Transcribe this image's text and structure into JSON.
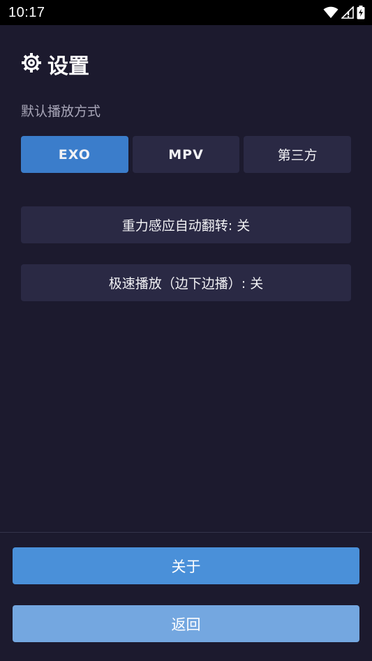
{
  "status_bar": {
    "time": "10:17"
  },
  "header": {
    "icon": "gear-icon",
    "title": "设置"
  },
  "playback": {
    "label": "默认播放方式",
    "options": [
      {
        "label": "EXO",
        "selected": true
      },
      {
        "label": "MPV",
        "selected": false
      },
      {
        "label": "第三方",
        "selected": false
      }
    ]
  },
  "settings": {
    "gravity_rotate": "重力感应自动翻转: 关",
    "speed_play": "极速播放（边下边播）: 关"
  },
  "footer": {
    "about": "关于",
    "back": "返回"
  },
  "colors": {
    "background": "#1c1a2e",
    "selected": "#3b7dcb",
    "button": "#2a2944",
    "about": "#4a90d9",
    "back": "#74a7e0"
  }
}
